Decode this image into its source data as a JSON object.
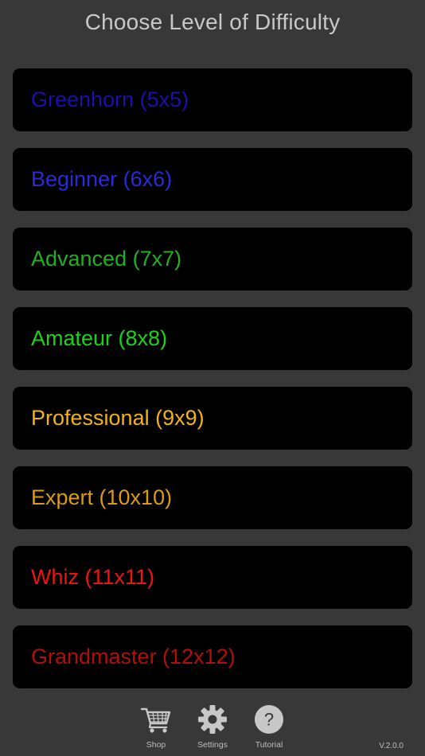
{
  "header": {
    "title": "Choose Level of Difficulty"
  },
  "levels": [
    {
      "label": "Greenhorn (5x5)",
      "color": "#1c10a8"
    },
    {
      "label": "Beginner (6x6)",
      "color": "#2a2bd6"
    },
    {
      "label": "Advanced (7x7)",
      "color": "#22b022"
    },
    {
      "label": "Amateur (8x8)",
      "color": "#19d419"
    },
    {
      "label": "Professional (9x9)",
      "color": "#f2b319"
    },
    {
      "label": "Expert (10x10)",
      "color": "#d99a18"
    },
    {
      "label": "Whiz (11x11)",
      "color": "#ee1414"
    },
    {
      "label": "Grandmaster (12x12)",
      "color": "#b00f0f"
    }
  ],
  "tabbar": {
    "shop_label": "Shop",
    "shop_icon": "cart-icon",
    "settings_label": "Settings",
    "settings_icon": "gear-icon",
    "tutorial_label": "Tutorial",
    "tutorial_icon": "question-icon"
  },
  "version": "V.2.0.0"
}
